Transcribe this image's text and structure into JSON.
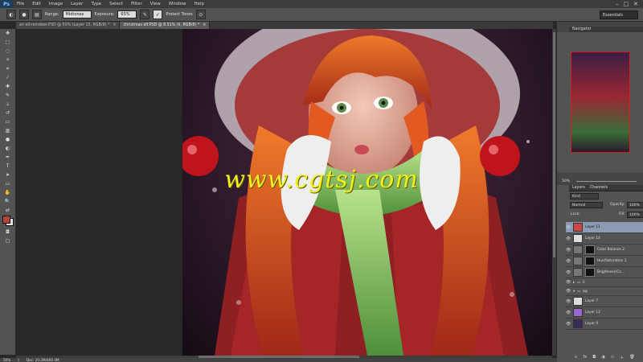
{
  "menubar": {
    "logo": "Ps",
    "items": [
      "File",
      "Edit",
      "Image",
      "Layer",
      "Type",
      "Select",
      "Filter",
      "View",
      "Window",
      "Help"
    ],
    "window_controls": [
      "–",
      "□",
      "✕"
    ]
  },
  "options": {
    "range_label": "Range:",
    "range_value": "Midtones",
    "exposure_label": "Exposure:",
    "exposure_value": "65%",
    "protect_tones": "Protect Tones",
    "workspace": "Essentials"
  },
  "tabs": [
    {
      "label": "an ell-reindeer.PSD @ 50% (Layer 15, RGB/8) *",
      "active": false
    },
    {
      "label": "christmas elf.PSD @ 8.51% (li, RGB/8) *",
      "active": true
    }
  ],
  "canvas": {
    "watermark": "www.cgtsj.com"
  },
  "status": {
    "zoom": "50%",
    "doc": "Doc: 20.2M/460.4M"
  },
  "navigator": {
    "tab": "Navigator",
    "zoom": "50%"
  },
  "layers_panel": {
    "tabs": [
      "Layers",
      "Channels"
    ],
    "kind": "Kind",
    "blend_mode": "Normal",
    "opacity_label": "Opacity:",
    "opacity": "100%",
    "lock_label": "Lock:",
    "fill_label": "Fill:",
    "fill": "100%",
    "layers": [
      {
        "name": "Layer 11",
        "selected": true,
        "mask": false
      },
      {
        "name": "Layer 14",
        "selected": false,
        "mask": false
      },
      {
        "name": "Color Balance 2",
        "selected": false,
        "mask": true
      },
      {
        "name": "Hue/Saturation 1",
        "selected": false,
        "mask": true
      },
      {
        "name": "Brightness/Co...",
        "selected": false,
        "mask": true
      },
      {
        "name": "li",
        "selected": false,
        "mask": false
      },
      {
        "name": "bg",
        "selected": false,
        "mask": false
      },
      {
        "name": "Layer 7",
        "selected": false,
        "mask": false
      },
      {
        "name": "Layer 12",
        "selected": false,
        "mask": false
      },
      {
        "name": "Layer 0",
        "selected": false,
        "mask": false
      }
    ]
  },
  "colors": {
    "accent": "#8a9bb3",
    "watermark": "#f2f01a"
  }
}
